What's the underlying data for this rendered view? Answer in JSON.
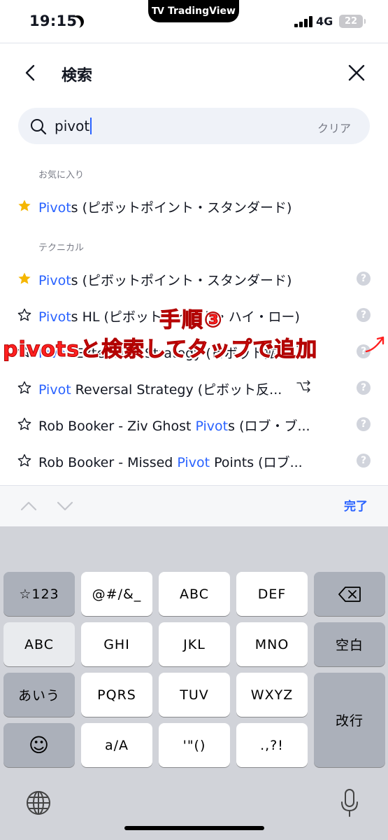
{
  "status_bar": {
    "time": "19:15",
    "app_pill": "TradingView",
    "app_pill_logo": "TV",
    "network": "4G",
    "battery": "22"
  },
  "header": {
    "title": "検索"
  },
  "search": {
    "value": "pivot",
    "clear_label": "クリア"
  },
  "sections": {
    "favorites_label": "お気に入り",
    "technical_label": "テクニカル"
  },
  "favorites": [
    {
      "highlight": "Pivot",
      "rest": "s (ピボットポイント・スタンダード)",
      "starred": true
    }
  ],
  "technicals": [
    {
      "prefix": "",
      "highlight": "Pivot",
      "rest": "s (ピボットポイント・スタンダード)",
      "starred": true,
      "strategy": false
    },
    {
      "prefix": "",
      "highlight": "Pivot",
      "rest": "s HL (ピボットポイント・ハイ・ロー)",
      "starred": false,
      "strategy": false
    },
    {
      "prefix": "",
      "highlight": "Pivot",
      "rest": " Extension Strategy (ピボット拡...",
      "starred": false,
      "strategy": true
    },
    {
      "prefix": "",
      "highlight": "Pivot",
      "rest": " Reversal Strategy (ピボット反...",
      "starred": false,
      "strategy": true
    },
    {
      "prefix": "Rob Booker - Ziv Ghost ",
      "highlight": "Pivot",
      "rest": "s (ロブ・ブ...",
      "starred": false,
      "strategy": false
    },
    {
      "prefix": "Rob Booker - Missed ",
      "highlight": "Pivot",
      "rest": " Points (ロブ...",
      "starred": false,
      "strategy": false
    }
  ],
  "help_glyph": "?",
  "accessory": {
    "done_label": "完了"
  },
  "keyboard": {
    "rows": [
      [
        "☆123",
        "@#/&_",
        "ABC",
        "DEF",
        "⌫"
      ],
      [
        "ABC",
        "GHI",
        "JKL",
        "MNO",
        "空白"
      ],
      [
        "あいう",
        "PQRS",
        "TUV",
        "WXYZ",
        "改行"
      ],
      [
        "☺",
        "a/A",
        "'\"()",
        ".,?!"
      ]
    ]
  },
  "annotation": {
    "step": "手順③",
    "instruction": "pivotsと検索してタップで追加"
  },
  "colors": {
    "accent": "#2962ff",
    "star": "#f5b600",
    "annotation": "#ff2020"
  }
}
